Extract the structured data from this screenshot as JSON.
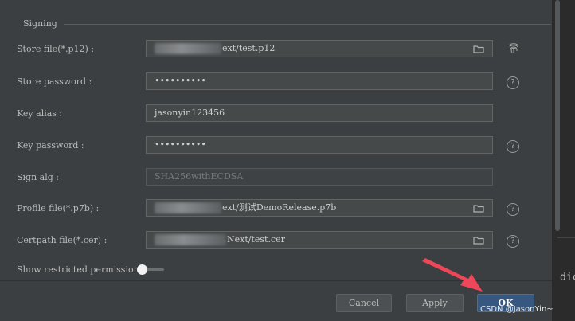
{
  "section": {
    "title": "Signing"
  },
  "fields": [
    {
      "label": "Store file(*.p12) :",
      "value": "ext/test.p12"
    },
    {
      "label": "Store password :",
      "value": "••••••••••"
    },
    {
      "label": "Key alias :",
      "value": "jasonyin123456"
    },
    {
      "label": "Key password :",
      "value": "••••••••••"
    },
    {
      "label": "Sign alg :",
      "value": "SHA256withECDSA"
    },
    {
      "label": "Profile file(*.p7b) :",
      "value": "ext/测试DemoRelease.p7b"
    },
    {
      "label": "Certpath file(*.cer) :",
      "value": "Next/test.cer"
    }
  ],
  "restricted": {
    "label": "Show restricted permissions",
    "enabled": false
  },
  "buttons": {
    "cancel": "Cancel",
    "apply": "Apply",
    "ok": "OK"
  },
  "background": {
    "code_fragment": "dic"
  },
  "watermark": "CSDN @JasonYin~",
  "icons": {
    "folder": "folder-icon",
    "help": "help-icon",
    "fingerprint": "fingerprint-icon",
    "arrow": "arrow-annotation-icon"
  },
  "colors": {
    "ok_button": "#365880",
    "arrow": "#f0465a"
  }
}
